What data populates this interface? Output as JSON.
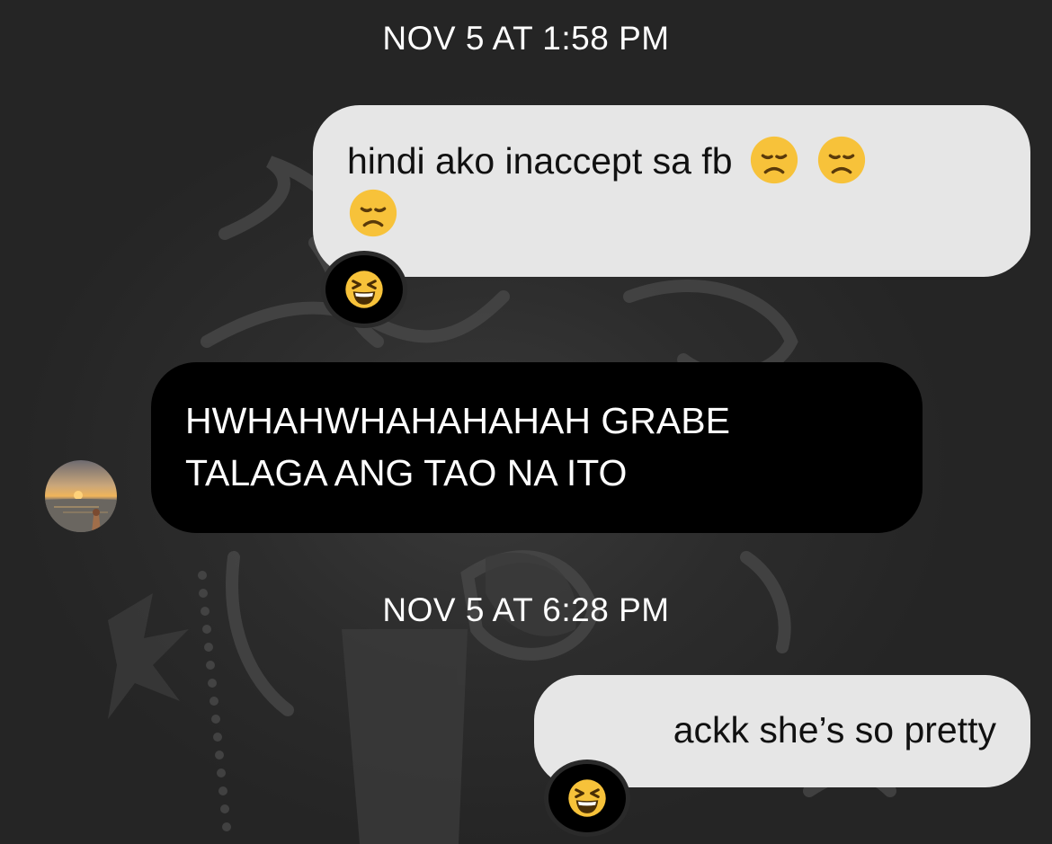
{
  "conversation": {
    "timestamps": [
      "NOV 5 AT 1:58 PM",
      "NOV 5 AT 6:28 PM"
    ],
    "messages": [
      {
        "direction": "outgoing",
        "text": "hindi ako inaccept sa fb",
        "emojis": [
          "disappointed-face-emoji",
          "disappointed-face-emoji",
          "disappointed-face-emoji"
        ],
        "reaction": "grinning-squinting-face-emoji"
      },
      {
        "direction": "incoming",
        "text": "HWHAHWHAHAHAHAH GRABE\nTALAGA ANG TAO NA ITO",
        "sender_avatar": "sunset-beach-photo"
      },
      {
        "direction": "outgoing",
        "text": "ackk she’s so pretty",
        "reaction": "grinning-squinting-face-emoji"
      }
    ]
  },
  "colors": {
    "background": "#2a2a2a",
    "outgoing_bubble": "#e6e6e6",
    "incoming_bubble": "#000000",
    "timestamp_text": "#ffffff",
    "emoji_yellow": "#f7c23a"
  }
}
